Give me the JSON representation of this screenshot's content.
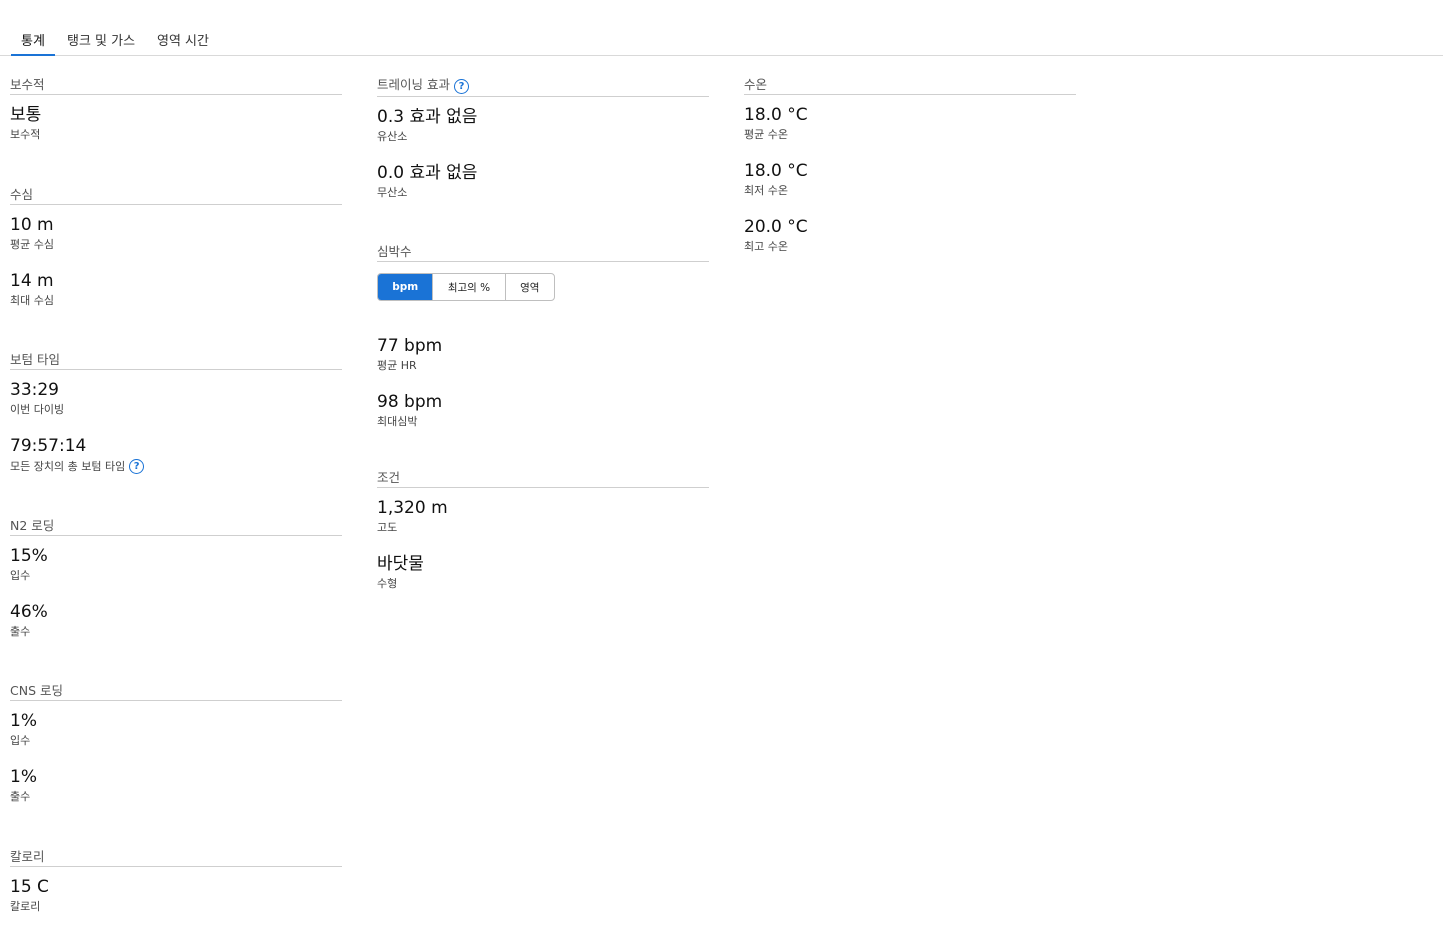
{
  "tabs": [
    {
      "label": "통계",
      "active": true
    },
    {
      "label": "탱크 및 가스",
      "active": false
    },
    {
      "label": "영역 시간",
      "active": false
    }
  ],
  "col1": {
    "conservatism": {
      "title": "보수적",
      "items": [
        {
          "value": "보통",
          "label": "보수적"
        }
      ]
    },
    "depth": {
      "title": "수심",
      "items": [
        {
          "value": "10 m",
          "label": "평균 수심"
        },
        {
          "value": "14 m",
          "label": "최대 수심"
        }
      ]
    },
    "bottom_time": {
      "title": "보텀 타임",
      "items": [
        {
          "value": "33:29",
          "label": "이번 다이빙"
        },
        {
          "value": "79:57:14",
          "label": "모든 장치의 총 보텀 타임"
        }
      ]
    },
    "n2": {
      "title": "N2 로딩",
      "items": [
        {
          "value": "15%",
          "label": "입수"
        },
        {
          "value": "46%",
          "label": "출수"
        }
      ]
    },
    "cns": {
      "title": "CNS 로딩",
      "items": [
        {
          "value": "1%",
          "label": "입수"
        },
        {
          "value": "1%",
          "label": "출수"
        }
      ]
    },
    "calories": {
      "title": "칼로리",
      "items": [
        {
          "value": "15 C",
          "label": "칼로리"
        }
      ]
    }
  },
  "col2": {
    "training": {
      "title": "트레이닝 효과",
      "items": [
        {
          "value": "0.3 효과 없음",
          "label": "유산소"
        },
        {
          "value": "0.0 효과 없음",
          "label": "무산소"
        }
      ]
    },
    "heart_rate": {
      "title": "심박수",
      "toggle": [
        {
          "label": "bpm",
          "active": true
        },
        {
          "label": "최고의 %",
          "active": false
        },
        {
          "label": "영역",
          "active": false
        }
      ],
      "items": [
        {
          "value": "77 bpm",
          "label": "평균 HR"
        },
        {
          "value": "98 bpm",
          "label": "최대심박"
        }
      ]
    },
    "conditions": {
      "title": "조건",
      "items": [
        {
          "value": "1,320 m",
          "label": "고도"
        },
        {
          "value": "바닷물",
          "label": "수형"
        }
      ]
    }
  },
  "col3": {
    "water_temp": {
      "title": "수온",
      "items": [
        {
          "value": "18.0 °C",
          "label": "평균 수온"
        },
        {
          "value": "18.0 °C",
          "label": "최저 수온"
        },
        {
          "value": "20.0 °C",
          "label": "최고 수온"
        }
      ]
    }
  },
  "help_glyph": "?",
  "colors": {
    "accent": "#1a73d6",
    "divider": "#cfcfcf"
  }
}
